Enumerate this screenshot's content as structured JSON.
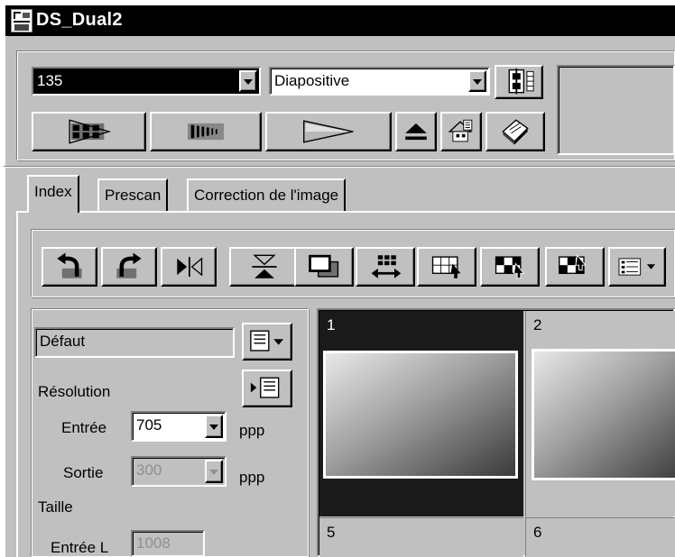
{
  "window": {
    "title": "DS_Dual2"
  },
  "film_format": {
    "value": "135"
  },
  "film_type": {
    "value": "Diapositive"
  },
  "toolbar_icons": [
    "index-scan-icon",
    "prescan-icon",
    "scan-icon",
    "eject-icon",
    "settings-icon",
    "help-book-icon"
  ],
  "tabs": [
    {
      "label": "Index"
    },
    {
      "label": "Prescan"
    },
    {
      "label": "Correction de l'image"
    }
  ],
  "image_tools": [
    "rotate-left-icon",
    "rotate-right-icon",
    "flip-horizontal-icon",
    "flip-vertical-icon",
    "crop-frames-icon",
    "swap-icon",
    "select-all-icon",
    "select-odd-icon",
    "select-even-icon",
    "view-options-icon"
  ],
  "settings": {
    "preset": "Défaut",
    "resolution_label": "Résolution",
    "input_label": "Entrée",
    "input_value": "705",
    "unit": "ppp",
    "output_label": "Sortie",
    "output_value": "300",
    "size_label": "Taille",
    "size_input_label": "Entrée L",
    "size_input_value": "1008"
  },
  "thumbnails": [
    {
      "number": "1"
    },
    {
      "number": "2"
    },
    {
      "number": "5"
    },
    {
      "number": "6"
    }
  ]
}
